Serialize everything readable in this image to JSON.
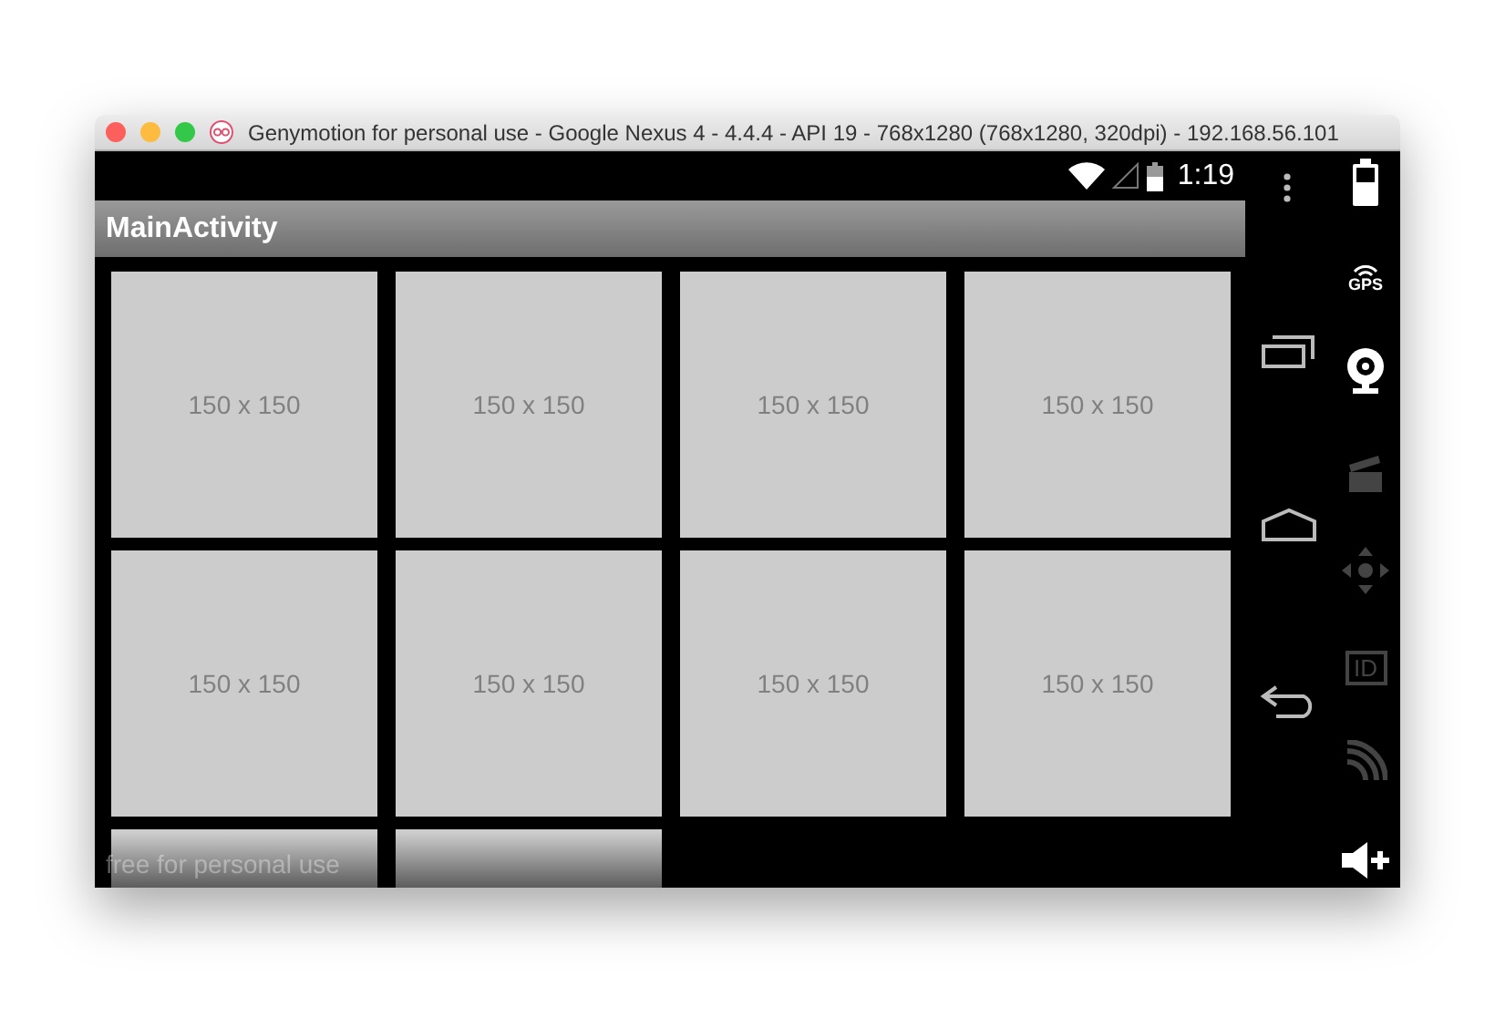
{
  "window": {
    "title": "Genymotion for personal use - Google Nexus 4 - 4.4.4 - API 19 - 768x1280 (768x1280, 320dpi) - 192.168.56.101"
  },
  "status_bar": {
    "time": "1:19"
  },
  "action_bar": {
    "title": "MainActivity"
  },
  "tiles": [
    {
      "label": "150 x 150"
    },
    {
      "label": "150 x 150"
    },
    {
      "label": "150 x 150"
    },
    {
      "label": "150 x 150"
    },
    {
      "label": "150 x 150"
    },
    {
      "label": "150 x 150"
    },
    {
      "label": "150 x 150"
    },
    {
      "label": "150 x 150"
    },
    {
      "kind": "image"
    },
    {
      "kind": "image"
    }
  ],
  "overlay_text": "free for personal use",
  "nav_buttons": [
    {
      "kind": "recents"
    },
    {
      "kind": "home"
    },
    {
      "kind": "back"
    }
  ],
  "sidebar": {
    "items": [
      {
        "kind": "battery",
        "disabled": false
      },
      {
        "kind": "gps",
        "label": "GPS",
        "disabled": false
      },
      {
        "kind": "webcam",
        "disabled": false
      },
      {
        "kind": "clapper",
        "disabled": true
      },
      {
        "kind": "dpad",
        "disabled": true
      },
      {
        "kind": "id",
        "label": "ID",
        "disabled": true
      },
      {
        "kind": "signal",
        "disabled": true
      },
      {
        "kind": "volume",
        "disabled": false
      }
    ]
  }
}
